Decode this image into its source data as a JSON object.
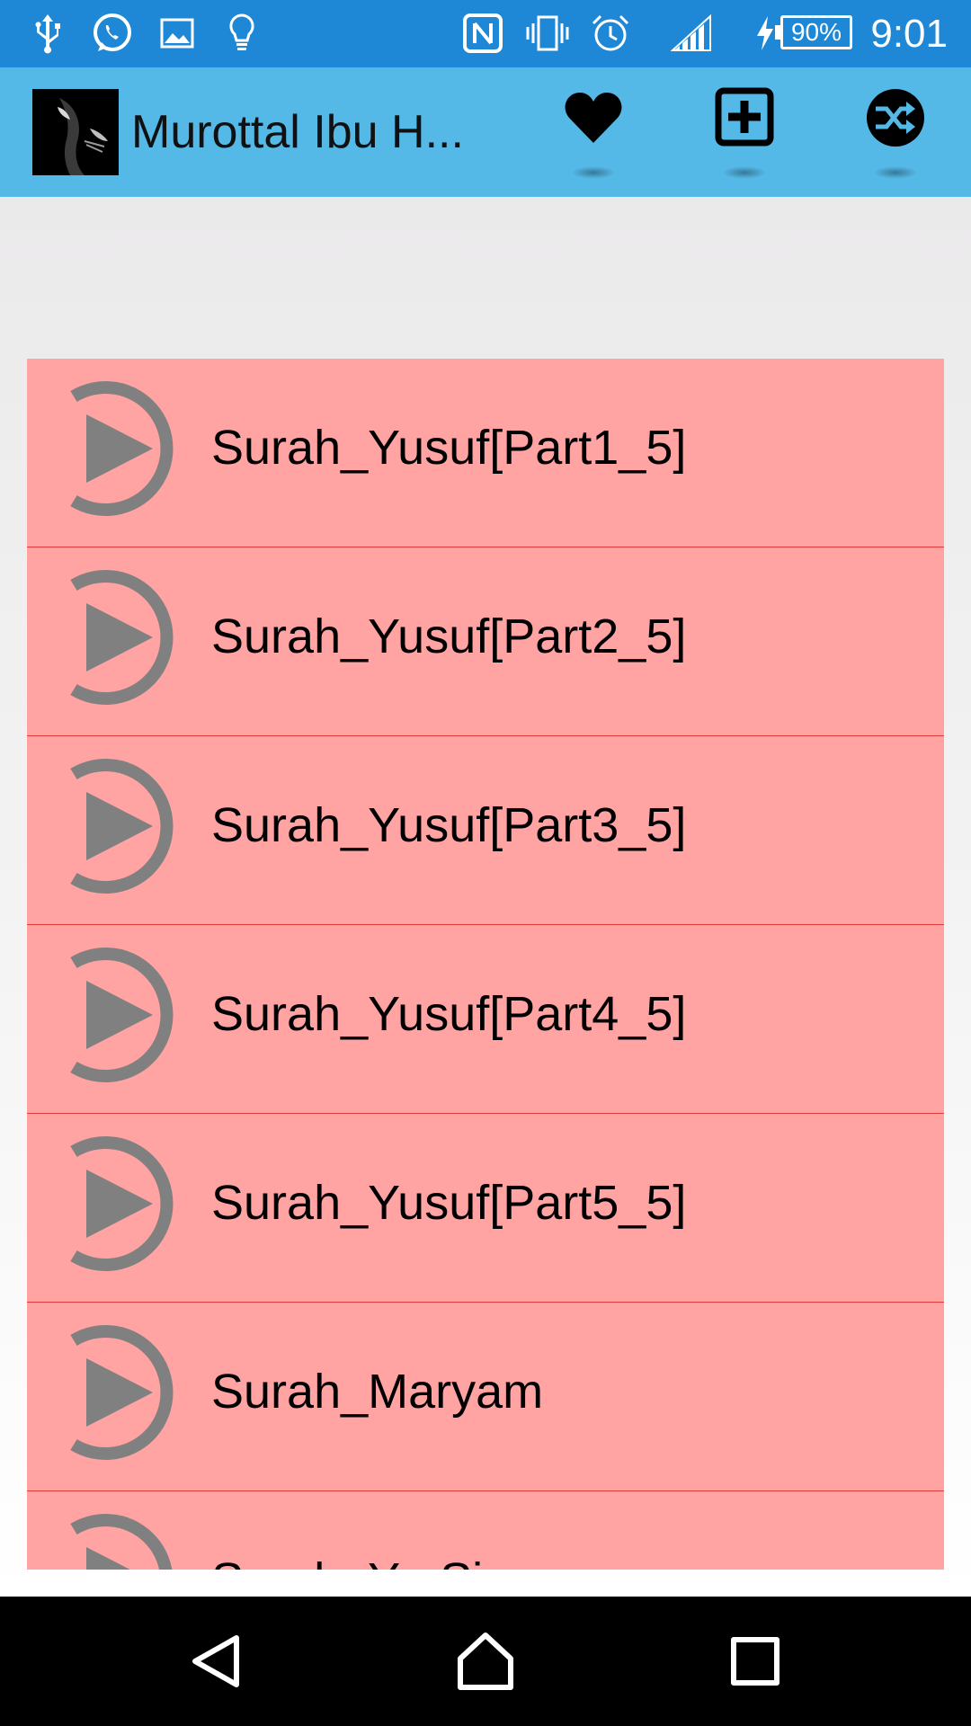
{
  "status_bar": {
    "icons": [
      "usb-icon",
      "whatsapp-icon",
      "image-icon",
      "lightbulb-icon",
      "nfc-icon",
      "vibrate-icon",
      "alarm-icon",
      "signal-icon",
      "charging-icon"
    ],
    "battery": "90%",
    "time": "9:01"
  },
  "app_bar": {
    "title": "Murottal Ibu H...",
    "actions": [
      "heart-icon",
      "add-box-icon",
      "shuffle-icon"
    ]
  },
  "colors": {
    "status_bar": "#1e88d6",
    "app_bar": "#55b9e8",
    "list_item": "#ffa3a3",
    "divider": "#e03a3a",
    "play_icon": "#808080"
  },
  "tracks": [
    {
      "title": "Surah_Yusuf[Part1_5]"
    },
    {
      "title": "Surah_Yusuf[Part2_5]"
    },
    {
      "title": "Surah_Yusuf[Part3_5]"
    },
    {
      "title": "Surah_Yusuf[Part4_5]"
    },
    {
      "title": "Surah_Yusuf[Part5_5]"
    },
    {
      "title": "Surah_Maryam"
    },
    {
      "title": "Surah_Ya-Sin"
    }
  ],
  "nav_bar": {
    "buttons": [
      "back-icon",
      "home-icon",
      "recents-icon"
    ]
  }
}
